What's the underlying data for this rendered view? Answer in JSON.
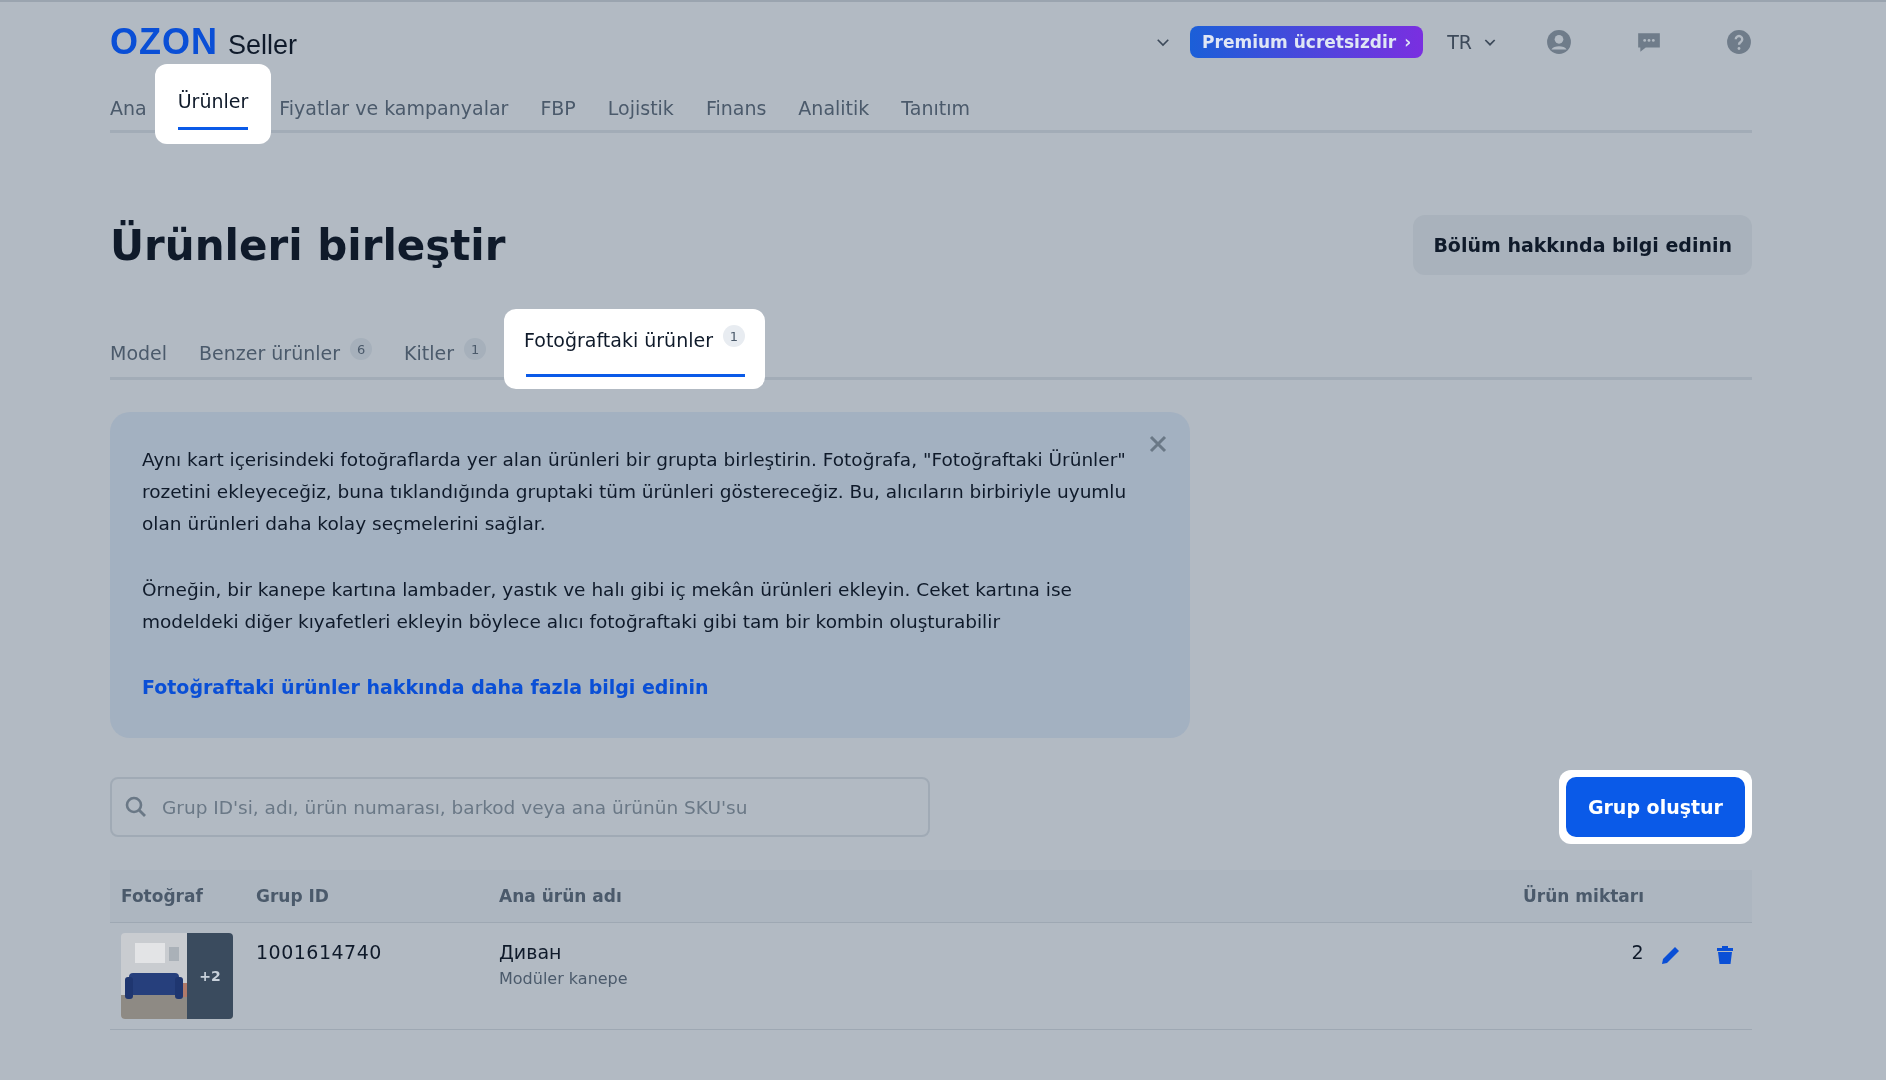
{
  "header": {
    "logo": "OZON",
    "logo_suffix": "Seller",
    "premium": "Premium ücretsizdir",
    "premium_arrow": "›",
    "language": "TR"
  },
  "nav": [
    {
      "label": "Ana",
      "selected": false
    },
    {
      "label": "Ürünler",
      "selected": true
    },
    {
      "label": "Fiyatlar ve kampanyalar",
      "selected": false
    },
    {
      "label": "FBP",
      "selected": false
    },
    {
      "label": "Lojistik",
      "selected": false
    },
    {
      "label": "Finans",
      "selected": false
    },
    {
      "label": "Analitik",
      "selected": false
    },
    {
      "label": "Tanıtım",
      "selected": false
    }
  ],
  "page": {
    "title": "Ürünleri birleştir",
    "info_button": "Bölüm hakkında bilgi edinin"
  },
  "tabs": [
    {
      "label": "Model",
      "selected": false
    },
    {
      "label": "Benzer ürünler",
      "count": "6",
      "selected": false
    },
    {
      "label": "Kitler",
      "count": "1",
      "selected": false
    },
    {
      "label": "Fotoğraftaki ürünler",
      "count": "1",
      "selected": true
    }
  ],
  "info": {
    "paragraphs": [
      "Aynı kart içerisindeki fotoğraflarda yer alan ürünleri bir grupta birleştirin. Fotoğrafa, \"Fotoğraftaki Ürünler\" rozetini ekleyeceğiz, buna tıklandığında gruptaki tüm ürünleri göstereceğiz. Bu, alıcıların birbiriyle uyumlu olan ürünleri daha kolay seçmelerini sağlar.",
      "Örneğin, bir kanepe kartına lambader, yastık ve halı gibi iç mekân ürünleri ekleyin. Ceket kartına ise modeldeki diğer kıyafetleri ekleyin böylece alıcı fotoğraftaki gibi tam bir kombin oluşturabilir"
    ],
    "link": "Fotoğraftaki ürünler hakkında daha fazla bilgi edinin"
  },
  "search": {
    "placeholder": "Grup ID'si, adı, ürün numarası, barkod veya ana ürünün SKU'su"
  },
  "create_button": "Grup oluştur",
  "table": {
    "columns": [
      "Fotoğraf",
      "Grup ID",
      "Ana ürün adı",
      "Ürün miktarı"
    ],
    "rows": [
      {
        "photo": {
          "kind": "picture",
          "extra": "+2"
        },
        "group_id": "1001614740",
        "name": "Диван",
        "subtitle": "Modüler kanepe",
        "quantity": "2"
      }
    ]
  }
}
